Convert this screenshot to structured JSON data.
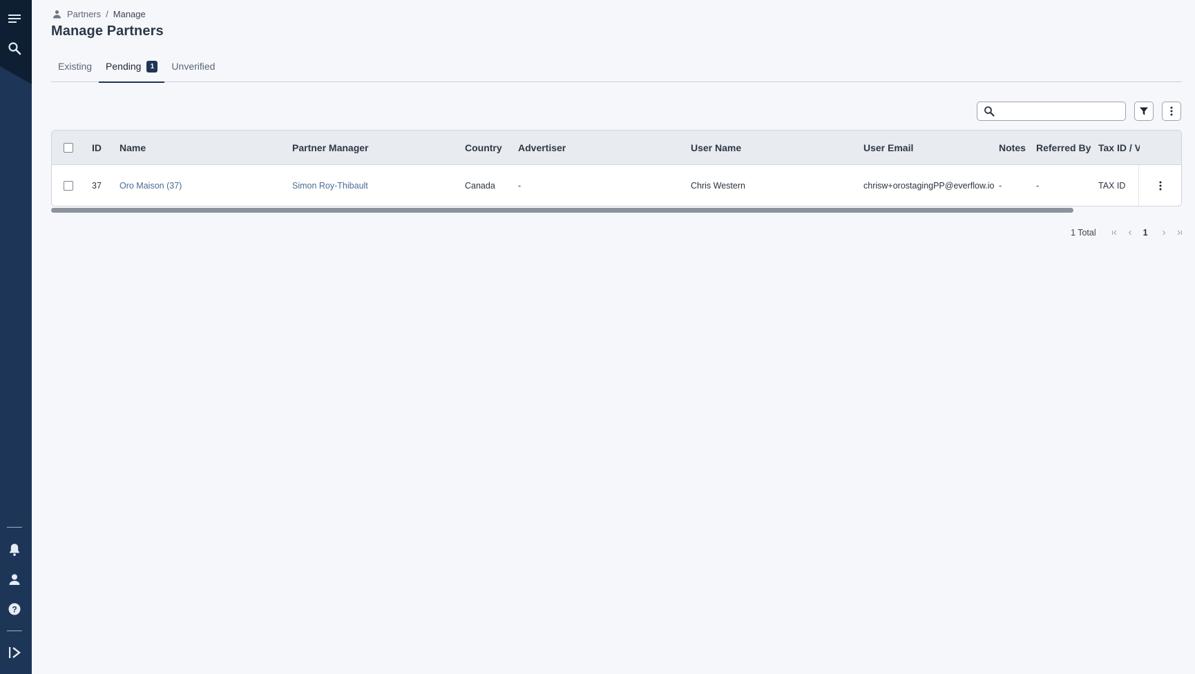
{
  "breadcrumb": {
    "root": "Partners",
    "separator": "/",
    "current": "Manage"
  },
  "page_title": "Manage Partners",
  "tabs": [
    {
      "label": "Existing",
      "active": false
    },
    {
      "label": "Pending",
      "active": true,
      "badge": "1"
    },
    {
      "label": "Unverified",
      "active": false
    }
  ],
  "search": {
    "placeholder": "",
    "value": ""
  },
  "table": {
    "headers": {
      "id": "ID",
      "name": "Name",
      "partner_manager": "Partner Manager",
      "country": "Country",
      "advertiser": "Advertiser",
      "user_name": "User Name",
      "user_email": "User Email",
      "notes": "Notes",
      "referred_by": "Referred By",
      "tax_id": "Tax ID / V"
    },
    "rows": [
      {
        "id": "37",
        "name": "Oro Maison (37)",
        "partner_manager": "Simon Roy-Thibault",
        "country": "Canada",
        "advertiser": "-",
        "user_name": "Chris Western",
        "user_email": "chrisw+orostagingPP@everflow.io",
        "notes": "-",
        "referred_by": "-",
        "tax_id": "TAX ID"
      }
    ]
  },
  "pagination": {
    "total_label": "1 Total",
    "current_page": "1"
  },
  "colors": {
    "sidebar": "#1d3557",
    "accent": "#1d3557",
    "link": "#4a6b92",
    "background": "#f6f7fb"
  },
  "icons": {
    "sidebar_top": [
      "menu-icon",
      "search-icon"
    ],
    "sidebar_bottom": [
      "bell-icon",
      "user-icon",
      "help-icon",
      "expand-sidebar-icon"
    ]
  }
}
